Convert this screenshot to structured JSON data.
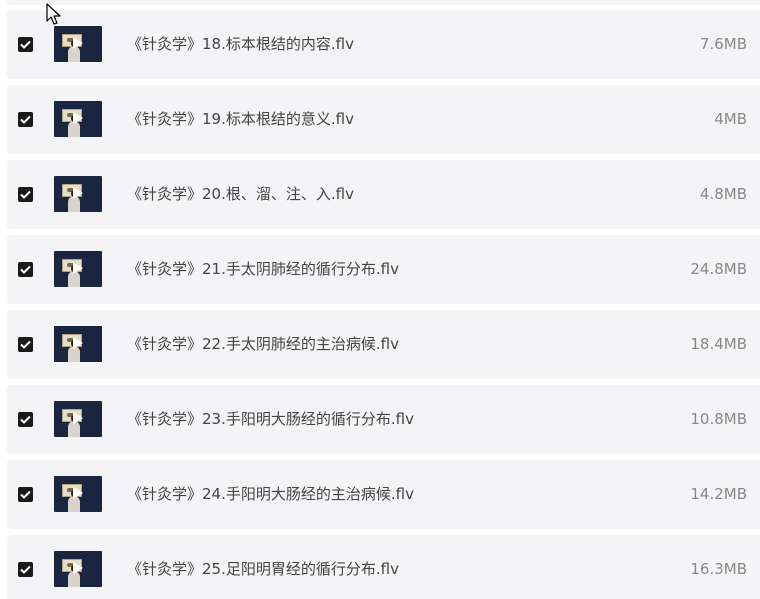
{
  "colors": {
    "row_bg": "#f4f4f6",
    "checkbox_bg": "#1a1a1a",
    "filename_text": "#444444",
    "filesize_text": "#888888",
    "thumb_bg": "#1a2540"
  },
  "icons": {
    "checkbox": "checkmark-icon",
    "thumbnail": "video-thumbnail-icon",
    "play": "play-icon",
    "cursor": "mouse-cursor-icon"
  },
  "files": [
    {
      "name": "《针灸学》18.标本根结的内容.flv",
      "size": "7.6MB",
      "checked": true
    },
    {
      "name": "《针灸学》19.标本根结的意义.flv",
      "size": "4MB",
      "checked": true
    },
    {
      "name": "《针灸学》20.根、溜、注、入.flv",
      "size": "4.8MB",
      "checked": true
    },
    {
      "name": "《针灸学》21.手太阴肺经的循行分布.flv",
      "size": "24.8MB",
      "checked": true
    },
    {
      "name": "《针灸学》22.手太阴肺经的主治病候.flv",
      "size": "18.4MB",
      "checked": true
    },
    {
      "name": "《针灸学》23.手阳明大肠经的循行分布.flv",
      "size": "10.8MB",
      "checked": true
    },
    {
      "name": "《针灸学》24.手阳明大肠经的主治病候.flv",
      "size": "14.2MB",
      "checked": true
    },
    {
      "name": "《针灸学》25.足阳明胃经的循行分布.flv",
      "size": "16.3MB",
      "checked": true
    }
  ]
}
